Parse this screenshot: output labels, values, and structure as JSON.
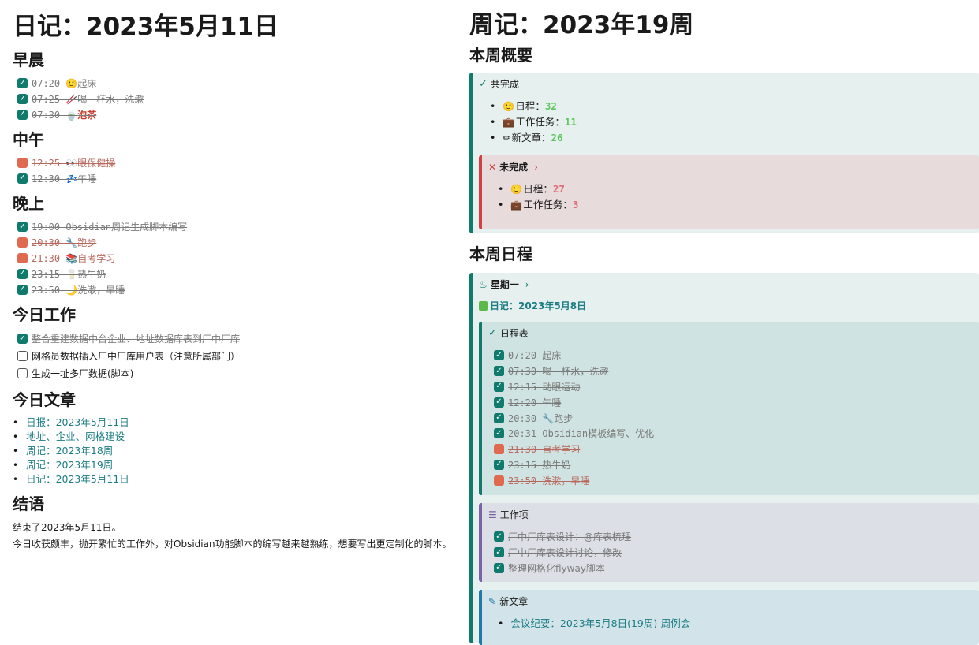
{
  "left": {
    "title": "日记：2023年5月11日",
    "morning": {
      "heading": "早晨",
      "tasks": [
        {
          "status": "done",
          "text": "07:20 🙂起床"
        },
        {
          "status": "done",
          "text": "07:25 🥢喝一杯水，洗漱"
        },
        {
          "status": "done",
          "text": "07:30 🍵",
          "extra": "泡茶"
        }
      ]
    },
    "noon": {
      "heading": "中午",
      "tasks": [
        {
          "status": "cancel",
          "text": "12:25 👀眼保健操"
        },
        {
          "status": "done",
          "text": "12:30 💤午睡"
        }
      ]
    },
    "evening": {
      "heading": "晚上",
      "tasks": [
        {
          "status": "done",
          "text": "19:00 Obsidian周记生成脚本编写"
        },
        {
          "status": "cancel",
          "text": "20:30 🔧跑步"
        },
        {
          "status": "cancel",
          "text": "21:30 📚自考学习"
        },
        {
          "status": "done",
          "text": "23:15 🥛热牛奶"
        },
        {
          "status": "done",
          "text": "23:50 🌙洗漱，早睡"
        }
      ]
    },
    "work": {
      "heading": "今日工作",
      "tasks": [
        {
          "status": "done",
          "text": "整合重建数据中台企业、地址数据库表到厂中厂库"
        },
        {
          "status": "open",
          "text": "网格员数据插入厂中厂库用户表（注意所属部门）"
        },
        {
          "status": "open",
          "text": "生成一址多厂数据(脚本)"
        }
      ]
    },
    "articles": {
      "heading": "今日文章",
      "links": [
        "日报：2023年5月11日",
        "地址、企业、网格建设",
        "周记：2023年18周",
        "周记：2023年19周",
        "日记：2023年5月11日"
      ]
    },
    "conclusion": {
      "heading": "结语",
      "line1": "结束了2023年5月11日。",
      "line2": "今日收获颇丰，抛开繁忙的工作外，对Obsidian功能脚本的编写越来越熟练，想要写出更定制化的脚本。"
    }
  },
  "right": {
    "title": "周记：2023年19周",
    "overview": {
      "heading": "本周概要",
      "done": {
        "label": "共完成",
        "items": [
          {
            "icon": "🙂",
            "label": "日程：",
            "value": "32"
          },
          {
            "icon": "💼",
            "label": "工作任务：",
            "value": "11"
          },
          {
            "icon": "✏",
            "label": "新文章：",
            "value": "26"
          }
        ]
      },
      "undone": {
        "label": "未完成",
        "items": [
          {
            "icon": "🙂",
            "label": "日程：",
            "value": "27"
          },
          {
            "icon": "💼",
            "label": "工作任务：",
            "value": "3"
          }
        ]
      }
    },
    "schedule": {
      "heading": "本周日程",
      "day": "星期一",
      "diary_link": "日记：2023年5月8日",
      "schedule_label": "日程表",
      "schedule_tasks": [
        {
          "status": "done",
          "text": "07:20 起床"
        },
        {
          "status": "done",
          "text": "07:30 喝一杯水，洗漱"
        },
        {
          "status": "done",
          "text": "12:15 动眼运动"
        },
        {
          "status": "done",
          "text": "12:20 午睡"
        },
        {
          "status": "done",
          "text": "20:30 🔧跑步"
        },
        {
          "status": "done",
          "text": "20:31 Obsidian模板编写、优化"
        },
        {
          "status": "cancel",
          "text": "21:30 自考学习"
        },
        {
          "status": "done",
          "text": "23:15 热牛奶"
        },
        {
          "status": "cancel",
          "text": "23:50 洗漱，早睡"
        }
      ],
      "work_label": "工作项",
      "work_tasks": [
        {
          "status": "done",
          "text": "厂中厂库表设计：@库表梳理"
        },
        {
          "status": "done",
          "text": "厂中厂库表设计讨论，修改"
        },
        {
          "status": "done",
          "text": "整理网格化flyway脚本"
        }
      ],
      "article_label": "新文章",
      "article_link": "会议纪要：2023年5月8日(19周)-周例会"
    }
  },
  "colors": {
    "teal": "#107a6c",
    "cancel": "#e06a50",
    "link": "#1b7c82",
    "red_callout": "#d04040",
    "purple": "#7a64a8",
    "blue": "#1e7aa8"
  }
}
